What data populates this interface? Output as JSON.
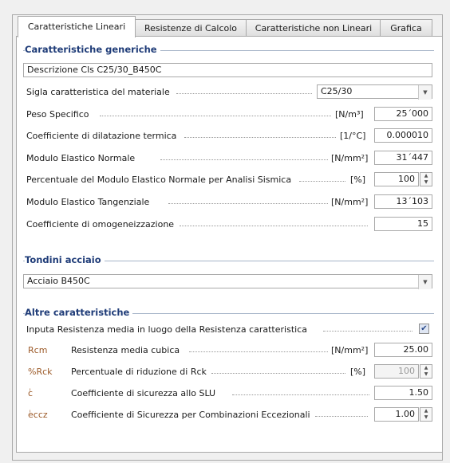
{
  "tabs": [
    {
      "label": "Caratteristiche Lineari",
      "active": true
    },
    {
      "label": "Resistenze di Calcolo",
      "active": false
    },
    {
      "label": "Caratteristiche non Lineari",
      "active": false
    },
    {
      "label": "Grafica",
      "active": false
    }
  ],
  "generic": {
    "title": "Caratteristiche generiche",
    "description_label": "Descrizione",
    "description_value": "Cls C25/30_B450C",
    "sigla_label": "Sigla caratteristica del materiale",
    "sigla_value": "C25/30",
    "peso_label": "Peso Specifico",
    "peso_unit": "[N/m³]",
    "peso_value": "25´000",
    "dilat_label": "Coefficiente di dilatazione termica",
    "dilat_unit": "[1/°C]",
    "dilat_value": "0.000010",
    "modulo_label": "Modulo Elastico Normale",
    "modulo_unit": "[N/mm²]",
    "modulo_value": "31´447",
    "perc_label": "Percentuale del Modulo Elastico Normale per Analisi Sismica",
    "perc_unit": "[%]",
    "perc_value": "100",
    "tang_label": "Modulo Elastico Tangenziale",
    "tang_unit": "[N/mm²]",
    "tang_value": "13´103",
    "omog_label": "Coefficiente di omogeneizzazione",
    "omog_value": "15"
  },
  "tondini": {
    "title": "Tondini acciaio",
    "value": "Acciaio B450C"
  },
  "altre": {
    "title": "Altre caratteristiche",
    "input_label": "Inputa Resistenza media in luogo della Resistenza caratteristica",
    "input_checked": true,
    "rcm_sym": "Rcm",
    "rcm_label": "Resistenza media cubica",
    "rcm_unit": "[N/mm²]",
    "rcm_value": "25.00",
    "rck_sym": "%Rck",
    "rck_label": "Percentuale di riduzione di Rck",
    "rck_unit": "[%]",
    "rck_value": "100",
    "gc_sym": "ٰc",
    "gc_label": "Coefficiente di sicurezza allo SLU",
    "gc_value": "1.50",
    "gecc_sym": "ٰeccz",
    "gecc_label": "Coefficiente di Sicurezza per Combinazioni Eccezionali",
    "gecc_value": "1.00"
  }
}
